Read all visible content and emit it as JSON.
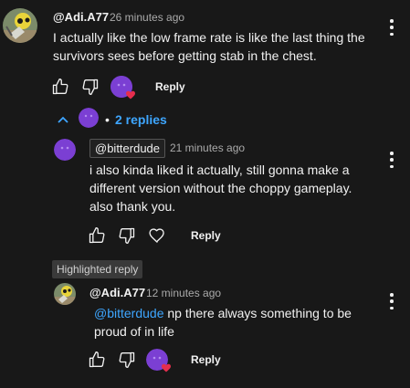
{
  "comments": {
    "top": {
      "handle": "@Adi.A77",
      "time": "26 minutes ago",
      "text": "I actually like the low frame rate is like the last thing the survivors sees before getting stab in the chest.",
      "reply_label": "Reply"
    },
    "replies_toggle": {
      "label": "2 replies",
      "bullet": "•"
    },
    "reply1": {
      "handle": "@bitterdude",
      "time": "21 minutes ago",
      "text": "i also kinda liked it actually, still gonna make a different version without the choppy gameplay. also thank you.",
      "reply_label": "Reply"
    },
    "reply2": {
      "badge": "Highlighted reply",
      "handle": "@Adi.A77",
      "time": "12 minutes ago",
      "mention": "@bitterdude",
      "text": " np there always something to be proud of in life",
      "reply_label": "Reply"
    }
  },
  "icons": {
    "like": "thumbs-up-icon",
    "dislike": "thumbs-down-icon",
    "heart": "heart-icon",
    "more": "more-vert-icon",
    "chevron": "chevron-up-icon"
  },
  "colors": {
    "background": "#181818",
    "link": "#3ea6ff",
    "creator_avatar": "#7b3fd3",
    "heart": "#e62e4d"
  }
}
